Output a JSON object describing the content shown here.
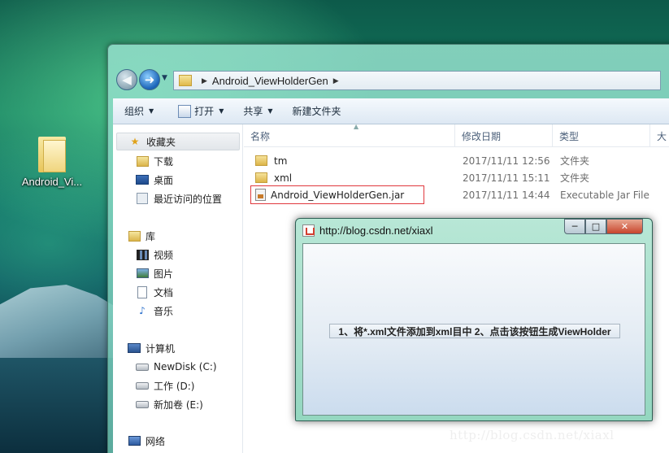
{
  "desktop": {
    "icon_label": "Android_Vi..."
  },
  "explorer": {
    "breadcrumb": "Android_ViewHolderGen",
    "toolbar": {
      "organize": "组织",
      "open": "打开",
      "share": "共享",
      "new_folder": "新建文件夹"
    },
    "nav": {
      "favorites": "收藏夹",
      "downloads": "下载",
      "desktop": "桌面",
      "recent": "最近访问的位置",
      "libraries": "库",
      "videos": "视频",
      "pictures": "图片",
      "documents": "文档",
      "music": "音乐",
      "computer": "计算机",
      "drive_c": "NewDisk (C:)",
      "drive_d": "工作 (D:)",
      "drive_e": "新加卷 (E:)",
      "network": "网络"
    },
    "columns": {
      "name": "名称",
      "modified": "修改日期",
      "type": "类型",
      "size": "大"
    },
    "files": [
      {
        "name": "tm",
        "modified": "2017/11/11 12:56",
        "type": "文件夹",
        "icon": "folder-icon"
      },
      {
        "name": "xml",
        "modified": "2017/11/11 15:11",
        "type": "文件夹",
        "icon": "folder-icon"
      },
      {
        "name": "Android_ViewHolderGen.jar",
        "modified": "2017/11/11 14:44",
        "type": "Executable Jar File",
        "icon": "jar-icon"
      }
    ]
  },
  "java_window": {
    "title": "http://blog.csdn.net/xiaxl",
    "button_label": "1、将*.xml文件添加到xml目中  2、点击该按钮生成ViewHolder"
  },
  "watermark": "http://blog.csdn.net/xiaxl",
  "colors": {
    "highlight_border": "#e0393e",
    "close_button": "#c7452c"
  }
}
